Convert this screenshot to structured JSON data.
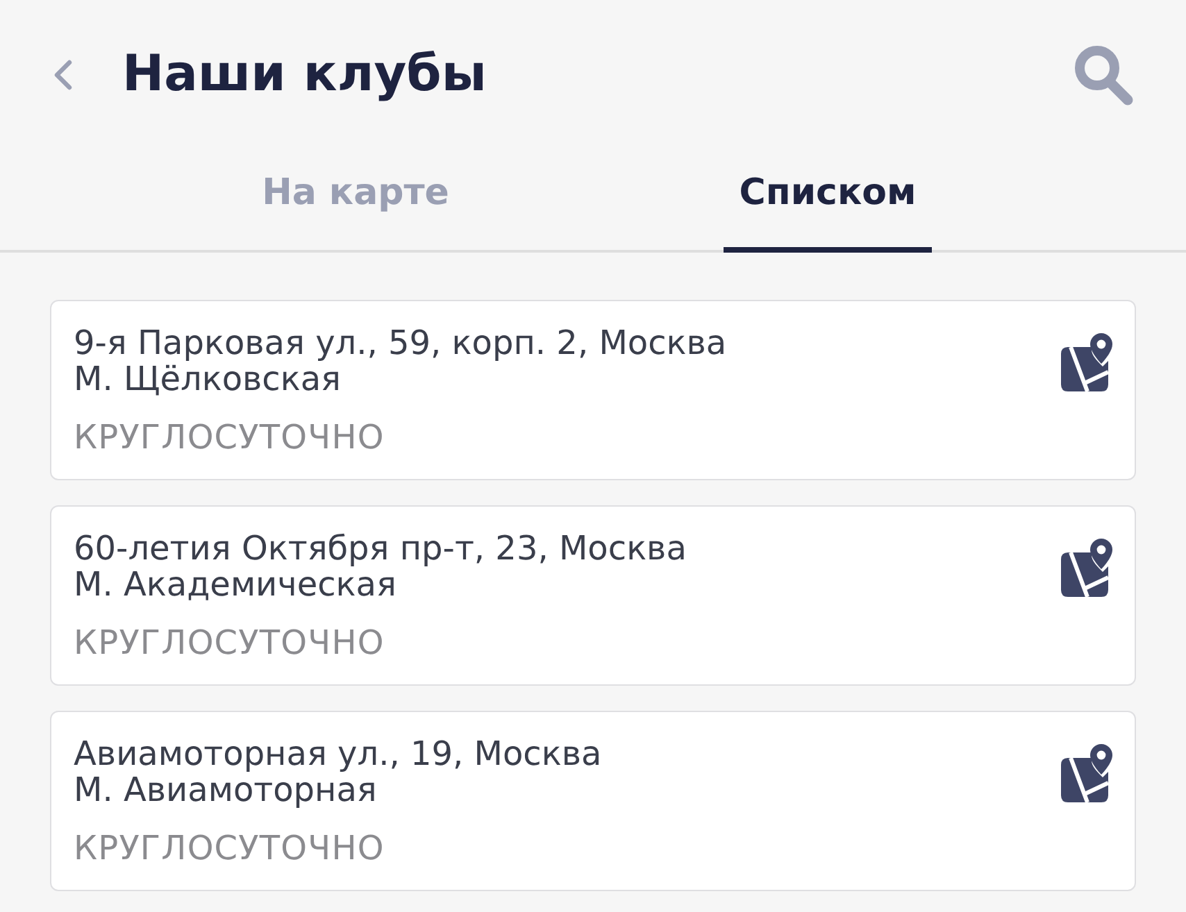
{
  "header": {
    "title": "Наши клубы"
  },
  "tabs": [
    {
      "label": "На карте",
      "selected": false
    },
    {
      "label": "Списком",
      "selected": true
    }
  ],
  "clubs": [
    {
      "address": "9-я Парковая ул., 59, корп. 2, Москва",
      "metro": "М. Щёлковская",
      "hours": "КРУГЛОСУТОЧНО"
    },
    {
      "address": "60-летия Октября пр-т, 23, Москва",
      "metro": "М. Академическая",
      "hours": "КРУГЛОСУТОЧНО"
    },
    {
      "address": "Авиамоторная ул., 19, Москва",
      "metro": "М. Авиамоторная",
      "hours": "КРУГЛОСУТОЧНО"
    }
  ]
}
